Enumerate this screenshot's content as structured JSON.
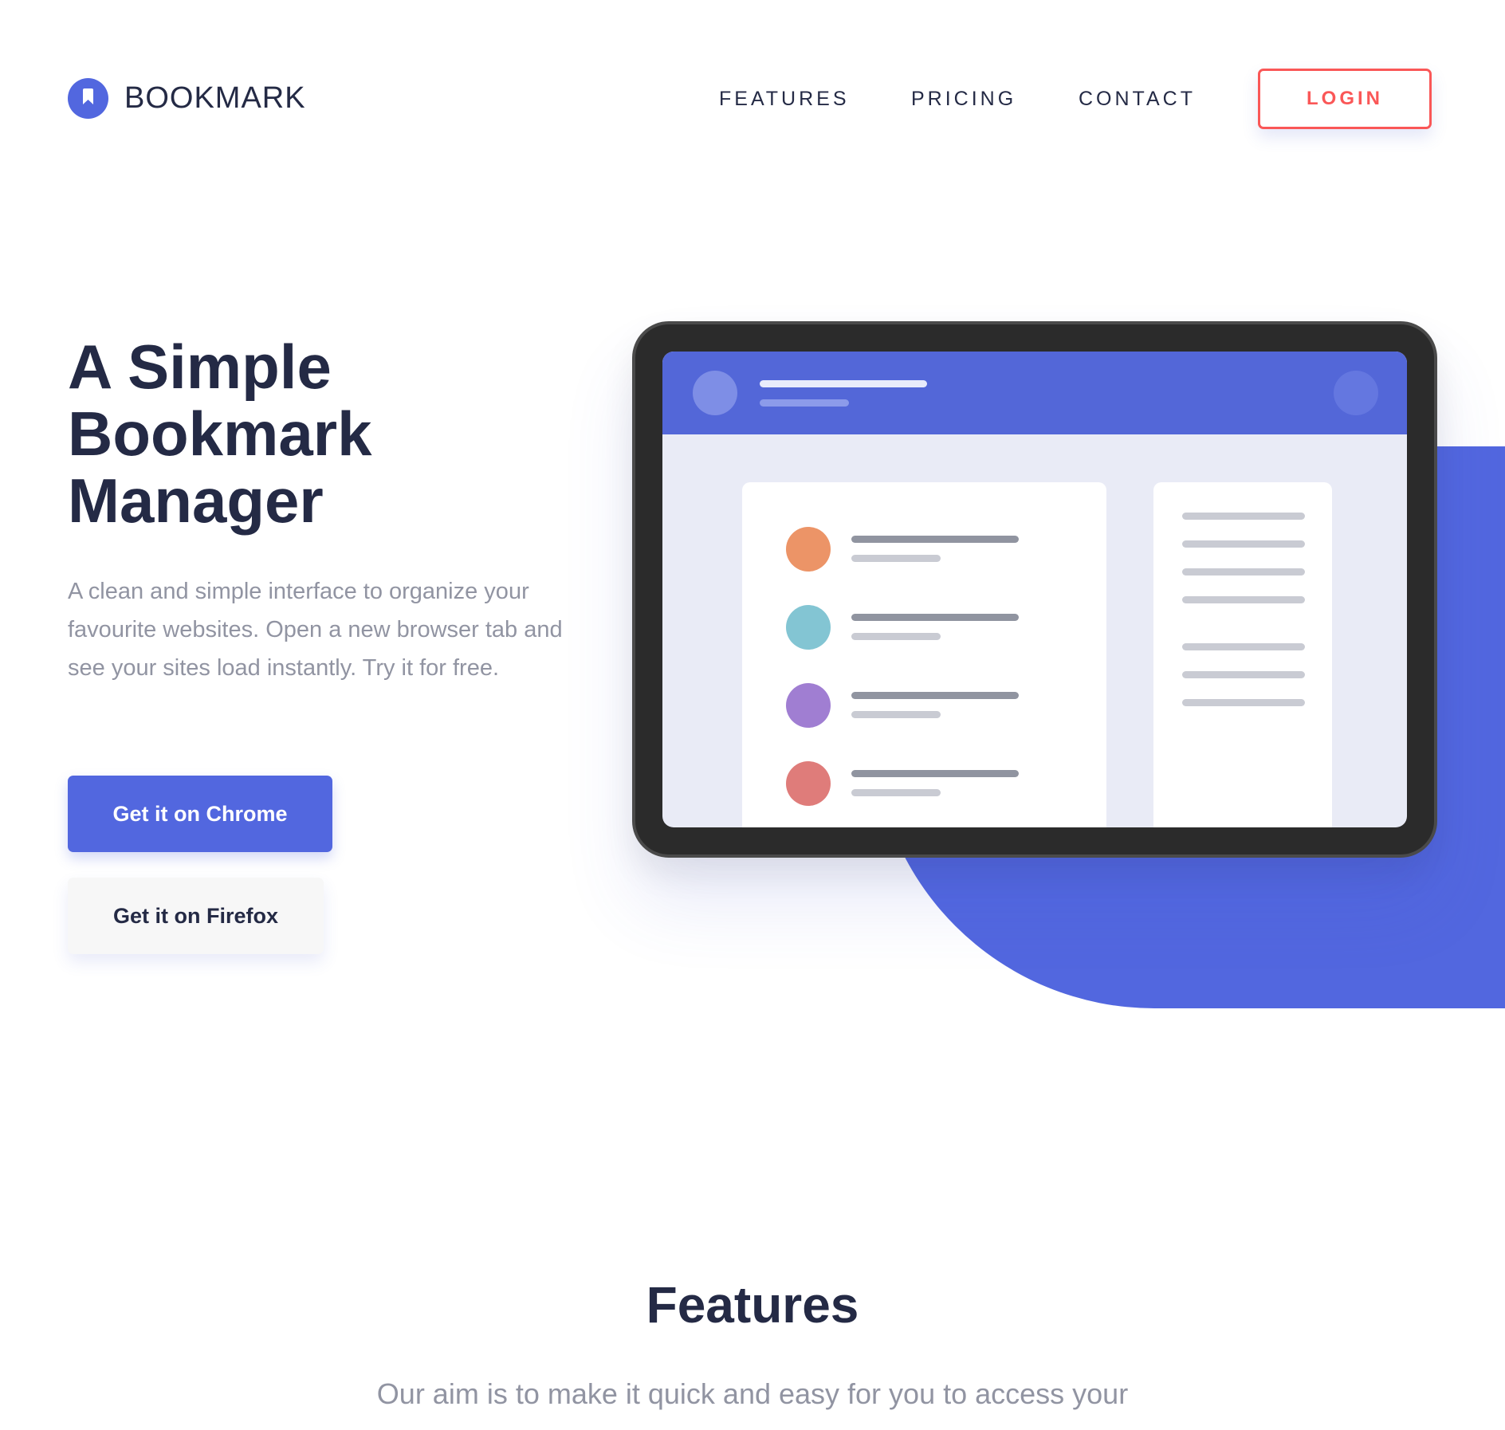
{
  "brand": {
    "name": "BOOKMARK",
    "icon": "bookmark-icon",
    "color": "#5267DF"
  },
  "nav": {
    "items": [
      {
        "label": "FEATURES"
      },
      {
        "label": "PRICING"
      },
      {
        "label": "CONTACT"
      }
    ],
    "login_label": "LOGIN"
  },
  "hero": {
    "title": "A Simple Bookmark Manager",
    "text": "A clean and simple interface to organize your favourite websites. Open a new browser tab and see your sites load instantly. Try it for free.",
    "chrome_button": "Get it on Chrome",
    "firefox_button": "Get it on Firefox"
  },
  "features": {
    "title": "Features",
    "text": "Our aim is to make it quick and easy for you to access your"
  },
  "colors": {
    "primary": "#5267DF",
    "accent": "#FA5757",
    "text_dark": "#242A45",
    "text_muted": "#9194A2",
    "bookmark_circles": [
      "#EC9467",
      "#83C5D3",
      "#A07ED2",
      "#DF7C7A"
    ]
  }
}
